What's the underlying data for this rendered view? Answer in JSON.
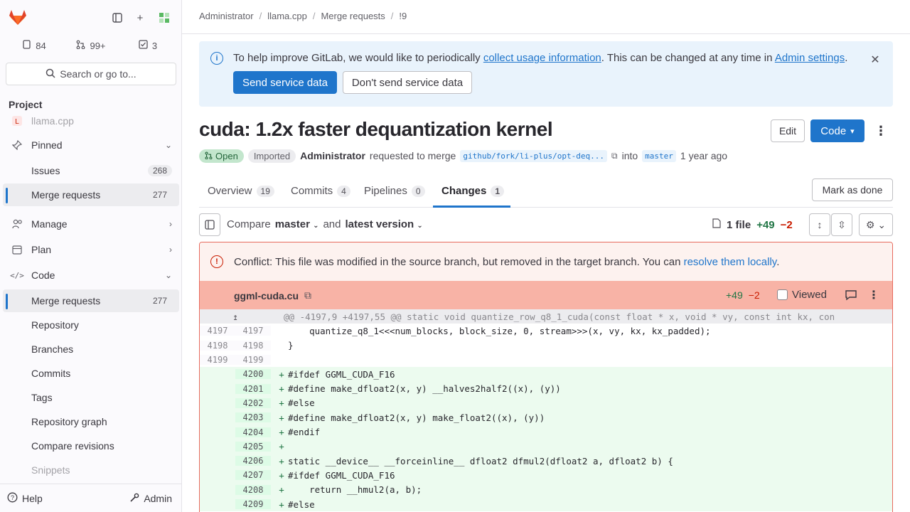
{
  "sidebar": {
    "counters": [
      {
        "icon": "issues-icon",
        "value": "84"
      },
      {
        "icon": "merge-request-icon",
        "value": "99+"
      },
      {
        "icon": "todo-icon",
        "value": "3"
      }
    ],
    "search_label": "Search or go to...",
    "heading": "Project",
    "project_name": "llama.cpp",
    "items": [
      {
        "label": "Pinned"
      },
      {
        "label": "Issues",
        "badge": "268"
      },
      {
        "label": "Merge requests",
        "badge": "277"
      },
      {
        "label": "Manage"
      },
      {
        "label": "Plan"
      },
      {
        "label": "Code"
      },
      {
        "label": "Merge requests",
        "badge": "277"
      },
      {
        "label": "Repository"
      },
      {
        "label": "Branches"
      },
      {
        "label": "Commits"
      },
      {
        "label": "Tags"
      },
      {
        "label": "Repository graph"
      },
      {
        "label": "Compare revisions"
      },
      {
        "label": "Snippets"
      }
    ],
    "help_label": "Help",
    "admin_label": "Admin"
  },
  "breadcrumb": [
    "Administrator",
    "llama.cpp",
    "Merge requests",
    "!9"
  ],
  "banner": {
    "text_before": "To help improve GitLab, we would like to periodically ",
    "link1": "collect usage information",
    "text_middle": ". This can be changed at any time in ",
    "link2": "Admin settings",
    "text_after": ".",
    "primary_button": "Send service data",
    "secondary_button": "Don't send service data"
  },
  "mr": {
    "title": "cuda: 1.2x faster dequantization kernel",
    "edit_label": "Edit",
    "code_label": "Code",
    "status": "Open",
    "imported": "Imported",
    "author": "Administrator",
    "requested_text": "requested to merge",
    "source_branch": "github/fork/li-plus/opt-deq...",
    "into_text": "into",
    "target_branch": "master",
    "time": "1 year ago"
  },
  "tabs": [
    {
      "label": "Overview",
      "count": "19"
    },
    {
      "label": "Commits",
      "count": "4"
    },
    {
      "label": "Pipelines",
      "count": "0"
    },
    {
      "label": "Changes",
      "count": "1"
    }
  ],
  "mark_done_label": "Mark as done",
  "compare": {
    "compare_label": "Compare",
    "base": "master",
    "and_label": "and",
    "head": "latest version",
    "files": "1 file",
    "additions": "+49",
    "deletions": "−2"
  },
  "conflict": {
    "text": "Conflict: This file was modified in the source branch, but removed in the target branch. You can ",
    "link": "resolve them locally",
    "after": "."
  },
  "file": {
    "name": "ggml-cuda.cu",
    "additions": "+49",
    "deletions": "−2",
    "viewed_label": "Viewed"
  },
  "diff": {
    "hunk": "@@ -4197,9 +4197,55 @@ static void quantize_row_q8_1_cuda(const float * x, void * vy, const int kx, con",
    "lines": [
      {
        "type": "ctx",
        "old": "4197",
        "new": "4197",
        "code": "    quantize_q8_1<<<num_blocks, block_size, 0, stream>>>(x, vy, kx, kx_padded);"
      },
      {
        "type": "ctx",
        "old": "4198",
        "new": "4198",
        "code": "}"
      },
      {
        "type": "ctx",
        "old": "4199",
        "new": "4199",
        "code": ""
      },
      {
        "type": "add",
        "old": "",
        "new": "4200",
        "code": "#ifdef GGML_CUDA_F16"
      },
      {
        "type": "add",
        "old": "",
        "new": "4201",
        "code": "#define make_dfloat2(x, y) __halves2half2((x), (y))"
      },
      {
        "type": "add",
        "old": "",
        "new": "4202",
        "code": "#else"
      },
      {
        "type": "add",
        "old": "",
        "new": "4203",
        "code": "#define make_dfloat2(x, y) make_float2((x), (y))"
      },
      {
        "type": "add",
        "old": "",
        "new": "4204",
        "code": "#endif"
      },
      {
        "type": "add",
        "old": "",
        "new": "4205",
        "code": ""
      },
      {
        "type": "add",
        "old": "",
        "new": "4206",
        "code": "static __device__ __forceinline__ dfloat2 dfmul2(dfloat2 a, dfloat2 b) {"
      },
      {
        "type": "add",
        "old": "",
        "new": "4207",
        "code": "#ifdef GGML_CUDA_F16"
      },
      {
        "type": "add",
        "old": "",
        "new": "4208",
        "code": "    return __hmul2(a, b);"
      },
      {
        "type": "add",
        "old": "",
        "new": "4209",
        "code": "#else"
      }
    ]
  },
  "colors": {
    "accent": "#1f75cb",
    "added": "#217645",
    "removed": "#c91c00",
    "conflict_header": "#f8b3a6"
  }
}
